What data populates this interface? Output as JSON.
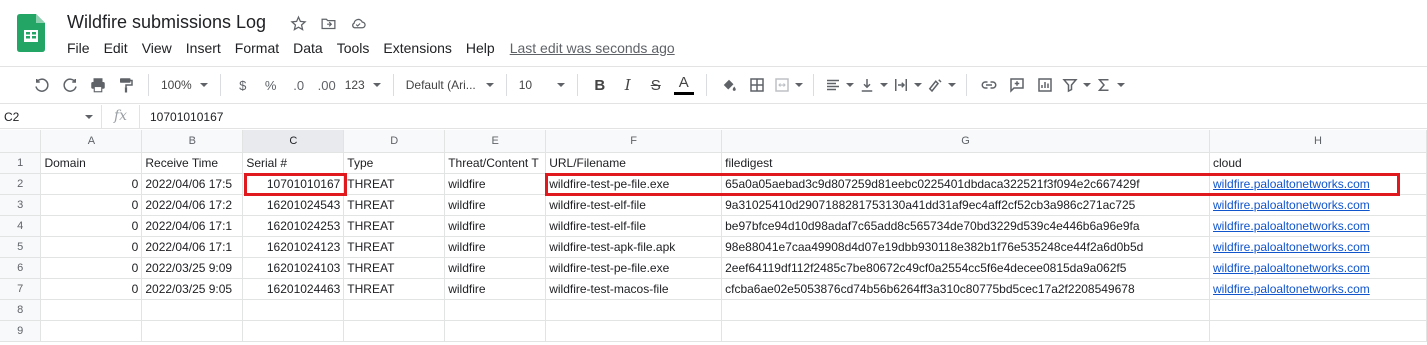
{
  "app": {
    "doc_title": "Wildfire submissions Log",
    "title_icons": [
      "star-icon",
      "move-to-folder-icon",
      "cloud-status-icon"
    ]
  },
  "menu": {
    "items": [
      "File",
      "Edit",
      "View",
      "Insert",
      "Format",
      "Data",
      "Tools",
      "Extensions",
      "Help"
    ],
    "last_edit": "Last edit was seconds ago"
  },
  "toolbar": {
    "zoom": "100%",
    "currency": "$",
    "percent": "%",
    "dec_decrease": ".0",
    "dec_increase": ".00",
    "more_formats": "123",
    "font": "Default (Ari...",
    "font_size": "10",
    "bold": "B",
    "italic": "I",
    "strike": "S",
    "text_color": "A"
  },
  "formula_bar": {
    "cell_ref": "C2",
    "fx": "fx",
    "value": "10701010167"
  },
  "sheet": {
    "col_letters": [
      "A",
      "B",
      "C",
      "D",
      "E",
      "F",
      "G",
      "H"
    ],
    "row_numbers": [
      "1",
      "2",
      "3",
      "4",
      "5",
      "6",
      "7",
      "8",
      "9"
    ],
    "headers": [
      "Domain",
      "Receive Time",
      "Serial #",
      "Type",
      "Threat/Content T",
      "URL/Filename",
      "filedigest",
      "cloud"
    ],
    "rows": [
      [
        "0",
        "2022/04/06 17:5",
        "10701010167",
        "THREAT",
        "wildfire",
        "wildfire-test-pe-file.exe",
        "65a0a05aebad3c9d807259d81eebc0225401dbdaca322521f3f094e2c667429f",
        "wildfire.paloaltonetworks.com"
      ],
      [
        "0",
        "2022/04/06 17:2",
        "16201024543",
        "THREAT",
        "wildfire",
        "wildfire-test-elf-file",
        "9a31025410d2907188281753130a41dd31af9ec4aff2cf52cb3a986c271ac725",
        "wildfire.paloaltonetworks.com"
      ],
      [
        "0",
        "2022/04/06 17:1",
        "16201024253",
        "THREAT",
        "wildfire",
        "wildfire-test-elf-file",
        "be97bfce94d10d98adaf7c65add8c565734de70bd3229d539c4e446b6a96e9fa",
        "wildfire.paloaltonetworks.com"
      ],
      [
        "0",
        "2022/04/06 17:1",
        "16201024123",
        "THREAT",
        "wildfire",
        "wildfire-test-apk-file.apk",
        "98e88041e7caa49908d4d07e19dbb930118e382b1f76e535248ce44f2a6d0b5d",
        "wildfire.paloaltonetworks.com"
      ],
      [
        "0",
        "2022/03/25 9:09",
        "16201024103",
        "THREAT",
        "wildfire",
        "wildfire-test-pe-file.exe",
        "2eef64119df112f2485c7be80672c49cf0a2554cc5f6e4decee0815da9a062f5",
        "wildfire.paloaltonetworks.com"
      ],
      [
        "0",
        "2022/03/25 9:05",
        "16201024463",
        "THREAT",
        "wildfire",
        "wildfire-test-macos-file",
        "cfcba6ae02e5053876cd74b56b6264ff3a310c80775bd5cec17a2f2208549678",
        "wildfire.paloaltonetworks.com"
      ]
    ]
  },
  "colors": {
    "highlight": "#e0191f",
    "link": "#1155cc",
    "sheets_green": "#23a566"
  }
}
